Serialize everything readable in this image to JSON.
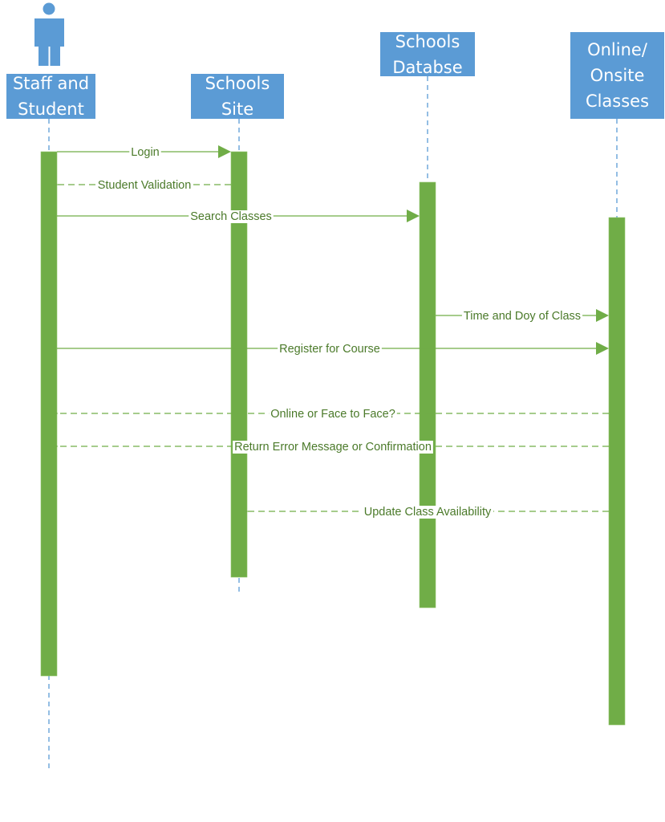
{
  "diagram": {
    "type": "uml-sequence-diagram",
    "colors": {
      "lifeline_box": "#5b9bd5",
      "lifeline_text": "#ffffff",
      "lifeline_dash": "#5b9bd5",
      "activation": "#70ad47",
      "message_line": "#70ad47",
      "message_text": "#4b7a2a",
      "actor_icon": "#5b9bd5"
    },
    "participants": [
      {
        "id": "staff",
        "label": "Staff and\nStudent",
        "actor_icon": "person-icon"
      },
      {
        "id": "site",
        "label": "Schools\nSite"
      },
      {
        "id": "db",
        "label": "Schools\nDatabse"
      },
      {
        "id": "classes",
        "label": "Online/\nOnsite\nClasses"
      }
    ],
    "messages": [
      {
        "from": "staff",
        "to": "site",
        "label": "Login",
        "style": "sync"
      },
      {
        "from": "site",
        "to": "staff",
        "label": "Student Validation",
        "style": "return"
      },
      {
        "from": "staff",
        "to": "db",
        "label": "Search Classes",
        "style": "sync"
      },
      {
        "from": "db",
        "to": "classes",
        "label": "Time and Doy of Class",
        "style": "sync"
      },
      {
        "from": "staff",
        "to": "classes",
        "label": "Register for Course",
        "style": "sync"
      },
      {
        "from": "classes",
        "to": "staff",
        "label": "Online or Face to Face?",
        "style": "return"
      },
      {
        "from": "classes",
        "to": "staff",
        "label": "Return Error Message or Confirmation",
        "style": "return"
      },
      {
        "from": "classes",
        "to": "site",
        "label": "Update Class Availability",
        "style": "return"
      }
    ]
  }
}
